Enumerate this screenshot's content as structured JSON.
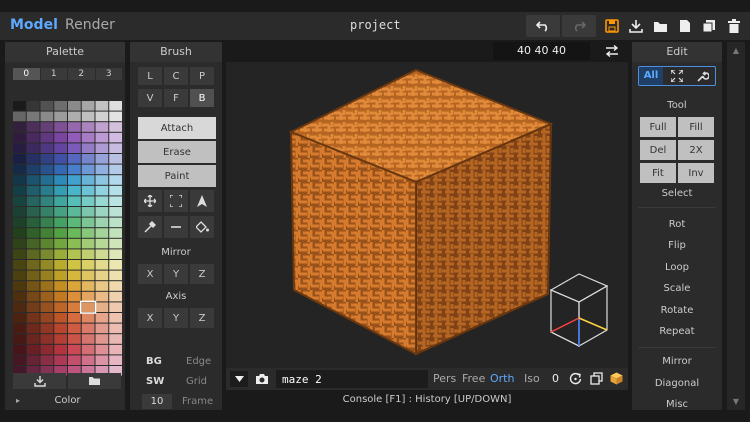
{
  "app": {
    "modes": [
      "Model",
      "Render"
    ],
    "active_mode": "Model",
    "project_name": "project"
  },
  "toolbar": {
    "icons": [
      "undo-icon",
      "redo-icon",
      "save-icon",
      "download-icon",
      "folder-icon",
      "file-icon",
      "copy-icon",
      "trash-icon"
    ],
    "accent_color": "#ff9800",
    "mode_color": "#5da9ff"
  },
  "palette": {
    "title": "Palette",
    "tabs": [
      "0",
      "1",
      "2",
      "3"
    ],
    "active_tab": "0",
    "footer_icons": [
      "import-icon",
      "folder-icon"
    ],
    "color_label": "Color"
  },
  "brush": {
    "title": "Brush",
    "shapes": [
      "L",
      "C",
      "P",
      "V",
      "F",
      "B"
    ],
    "active_shape": "B",
    "modes": [
      "Attach",
      "Erase",
      "Paint"
    ],
    "active_mode": "Attach",
    "tool_icons": [
      "move-icon",
      "select-icon",
      "cone-icon",
      "eyedropper-icon",
      "line-icon",
      "fill-icon"
    ],
    "mirror_label": "Mirror",
    "mirror_axes": [
      "X",
      "Y",
      "Z"
    ],
    "axis_label": "Axis",
    "axis_axes": [
      "X",
      "Y",
      "Z"
    ]
  },
  "view_settings": {
    "bg": "BG",
    "edge": "Edge",
    "sw": "SW",
    "grid": "Grid",
    "frame_value": "10",
    "frame": "Frame"
  },
  "viewport": {
    "dims": "40  40  40",
    "model_color": "#d17a2a",
    "background": "#242424"
  },
  "console": {
    "command": "maze 2",
    "camera_modes": [
      "Pers",
      "Free",
      "Orth"
    ],
    "active_camera": "Orth",
    "iso_label": "Iso",
    "iso_value": "0",
    "hint": "Console [F1] : History [UP/DOWN]"
  },
  "edit": {
    "title": "Edit",
    "filters": [
      "All",
      "fit-icon",
      "wrench-icon"
    ],
    "active_filter": "All",
    "tool_label": "Tool",
    "tool_buttons": [
      "Full",
      "Fill",
      "Del",
      "2X",
      "Fit",
      "Inv"
    ],
    "select_label": "Select",
    "menu": [
      "Rot",
      "Flip",
      "Loop",
      "Scale",
      "Rotate",
      "Repeat"
    ],
    "menu2": [
      "Mirror",
      "Diagonal",
      "Misc"
    ]
  }
}
